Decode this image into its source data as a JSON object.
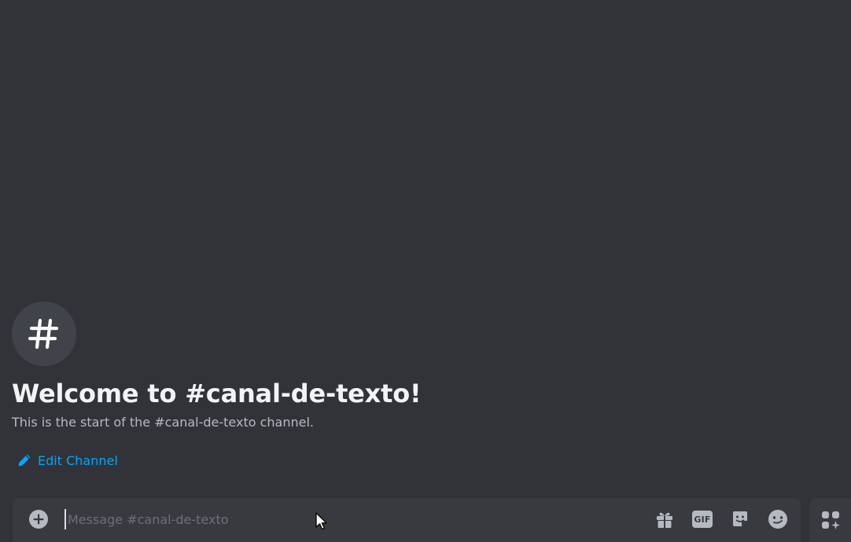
{
  "welcome": {
    "icon": "hashtag-icon",
    "title": "Welcome to #canal-de-texto!",
    "description": "This is the start of the #canal-de-texto channel.",
    "edit_label": "Edit Channel"
  },
  "composer": {
    "placeholder": "Message #canal-de-texto",
    "value": "",
    "attach_icon": "plus-circle-icon",
    "icons": [
      "gift-icon",
      "gif-icon",
      "sticker-icon",
      "emoji-icon"
    ],
    "gif_label": "GIF",
    "apps_icon": "apps-icon"
  },
  "colors": {
    "background": "#313338",
    "composer": "#383a40",
    "link": "#00a8fc",
    "title": "#f2f3f5",
    "muted": "#b5bac1"
  }
}
